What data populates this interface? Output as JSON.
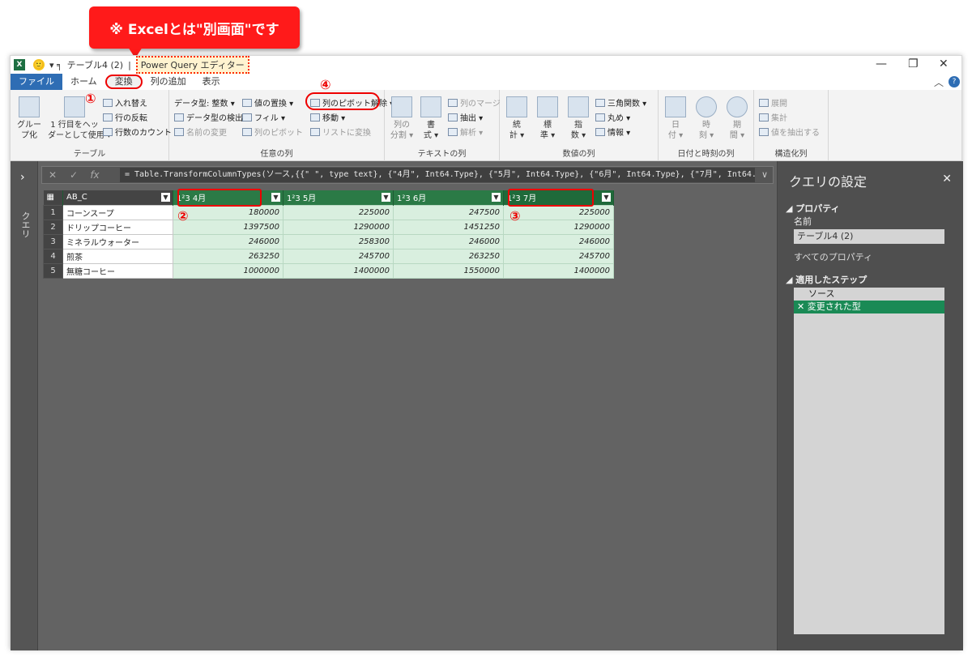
{
  "callout": {
    "text": "※ Excelとは\"別画面\"です"
  },
  "titlebar": {
    "app_icon": "X",
    "smile_icon": "🙂",
    "qat": "▾ ╕",
    "doc": "テーブル4 (2)",
    "sep": "|",
    "pq_title": "Power Query エディター",
    "min": "—",
    "restore": "❐",
    "close": "✕"
  },
  "tabs": {
    "file": "ファイル",
    "home": "ホーム",
    "transform": "変換",
    "add_column": "列の追加",
    "view": "表示",
    "collapse": "︿",
    "help": "?"
  },
  "ribbon": {
    "table": {
      "label": "テーブル",
      "group_by": "グルー\nプ化",
      "first_row": "1 行目をヘッ\nダーとして使用 ▾",
      "transpose": "入れ替え",
      "reverse": "行の反転",
      "count_rows": "行数のカウント"
    },
    "any_column": {
      "label": "任意の列",
      "data_type": "データ型: 整数 ▾",
      "detect": "データ型の検出",
      "rename": "名前の変更",
      "replace": "値の置換 ▾",
      "fill": "フィル ▾",
      "pivot": "列のピボット",
      "unpivot": "列のピボット解除 ▾",
      "move": "移動 ▾",
      "to_list": "リストに変換"
    },
    "text_column": {
      "label": "テキストの列",
      "split": "列の\n分割 ▾",
      "format": "書\n式 ▾",
      "merge": "列のマージ",
      "extract": "抽出 ▾",
      "parse": "解析 ▾"
    },
    "number_column": {
      "label": "数値の列",
      "stats": "統\n計 ▾",
      "standard": "標\n準 ▾",
      "scientific": "指\n数 ▾",
      "trig": "三角関数 ▾",
      "round": "丸め ▾",
      "info": "情報 ▾"
    },
    "datetime_column": {
      "label": "日付と時刻の列",
      "date": "日\n付 ▾",
      "time": "時\n刻 ▾",
      "duration": "期\n間 ▾"
    },
    "structured": {
      "label": "構造化列",
      "expand": "展開",
      "aggregate": "集計",
      "extract_values": "値を抽出する"
    }
  },
  "markers": {
    "m1": "①",
    "m2": "②",
    "m3": "③",
    "m4": "④"
  },
  "leftrail": {
    "arrow": "›",
    "label": "クエリ"
  },
  "formula": {
    "cancel": "✕",
    "ok": "✓",
    "fx": "fx",
    "text": "= Table.TransformColumnTypes(ソース,{{\" \", type text}, {\"4月\", Int64.Type}, {\"5月\", Int64.Type}, {\"6月\", Int64.Type}, {\"7月\", Int64.Type}",
    "dropdown": "∨"
  },
  "grid": {
    "columns": [
      {
        "type": "AB_C",
        "name": ""
      },
      {
        "type": "1²3",
        "name": "4月"
      },
      {
        "type": "1²3",
        "name": "5月"
      },
      {
        "type": "1²3",
        "name": "6月"
      },
      {
        "type": "1²3",
        "name": "7月"
      }
    ],
    "rows": [
      {
        "n": "1",
        "c0": "コーンスープ",
        "c1": "180000",
        "c2": "225000",
        "c3": "247500",
        "c4": "225000"
      },
      {
        "n": "2",
        "c0": "ドリップコーヒー",
        "c1": "1397500",
        "c2": "1290000",
        "c3": "1451250",
        "c4": "1290000"
      },
      {
        "n": "3",
        "c0": "ミネラルウォーター",
        "c1": "246000",
        "c2": "258300",
        "c3": "246000",
        "c4": "246000"
      },
      {
        "n": "4",
        "c0": "煎茶",
        "c1": "263250",
        "c2": "245700",
        "c3": "263250",
        "c4": "245700"
      },
      {
        "n": "5",
        "c0": "無糖コーヒー",
        "c1": "1000000",
        "c2": "1400000",
        "c3": "1550000",
        "c4": "1400000"
      }
    ]
  },
  "settings": {
    "title": "クエリの設定",
    "close": "✕",
    "properties": "◢ プロパティ",
    "name_label": "名前",
    "name_value": "テーブル4 (2)",
    "all_props": "すべてのプロパティ",
    "applied_steps": "◢ 適用したステップ",
    "steps": [
      "ソース",
      "✕ 変更された型"
    ]
  },
  "colors": {
    "accent_red": "#e00000",
    "ribbon_bg": "#f3f3f3",
    "grid_green": "#2b7a46",
    "cell_green": "#d9efdf"
  }
}
